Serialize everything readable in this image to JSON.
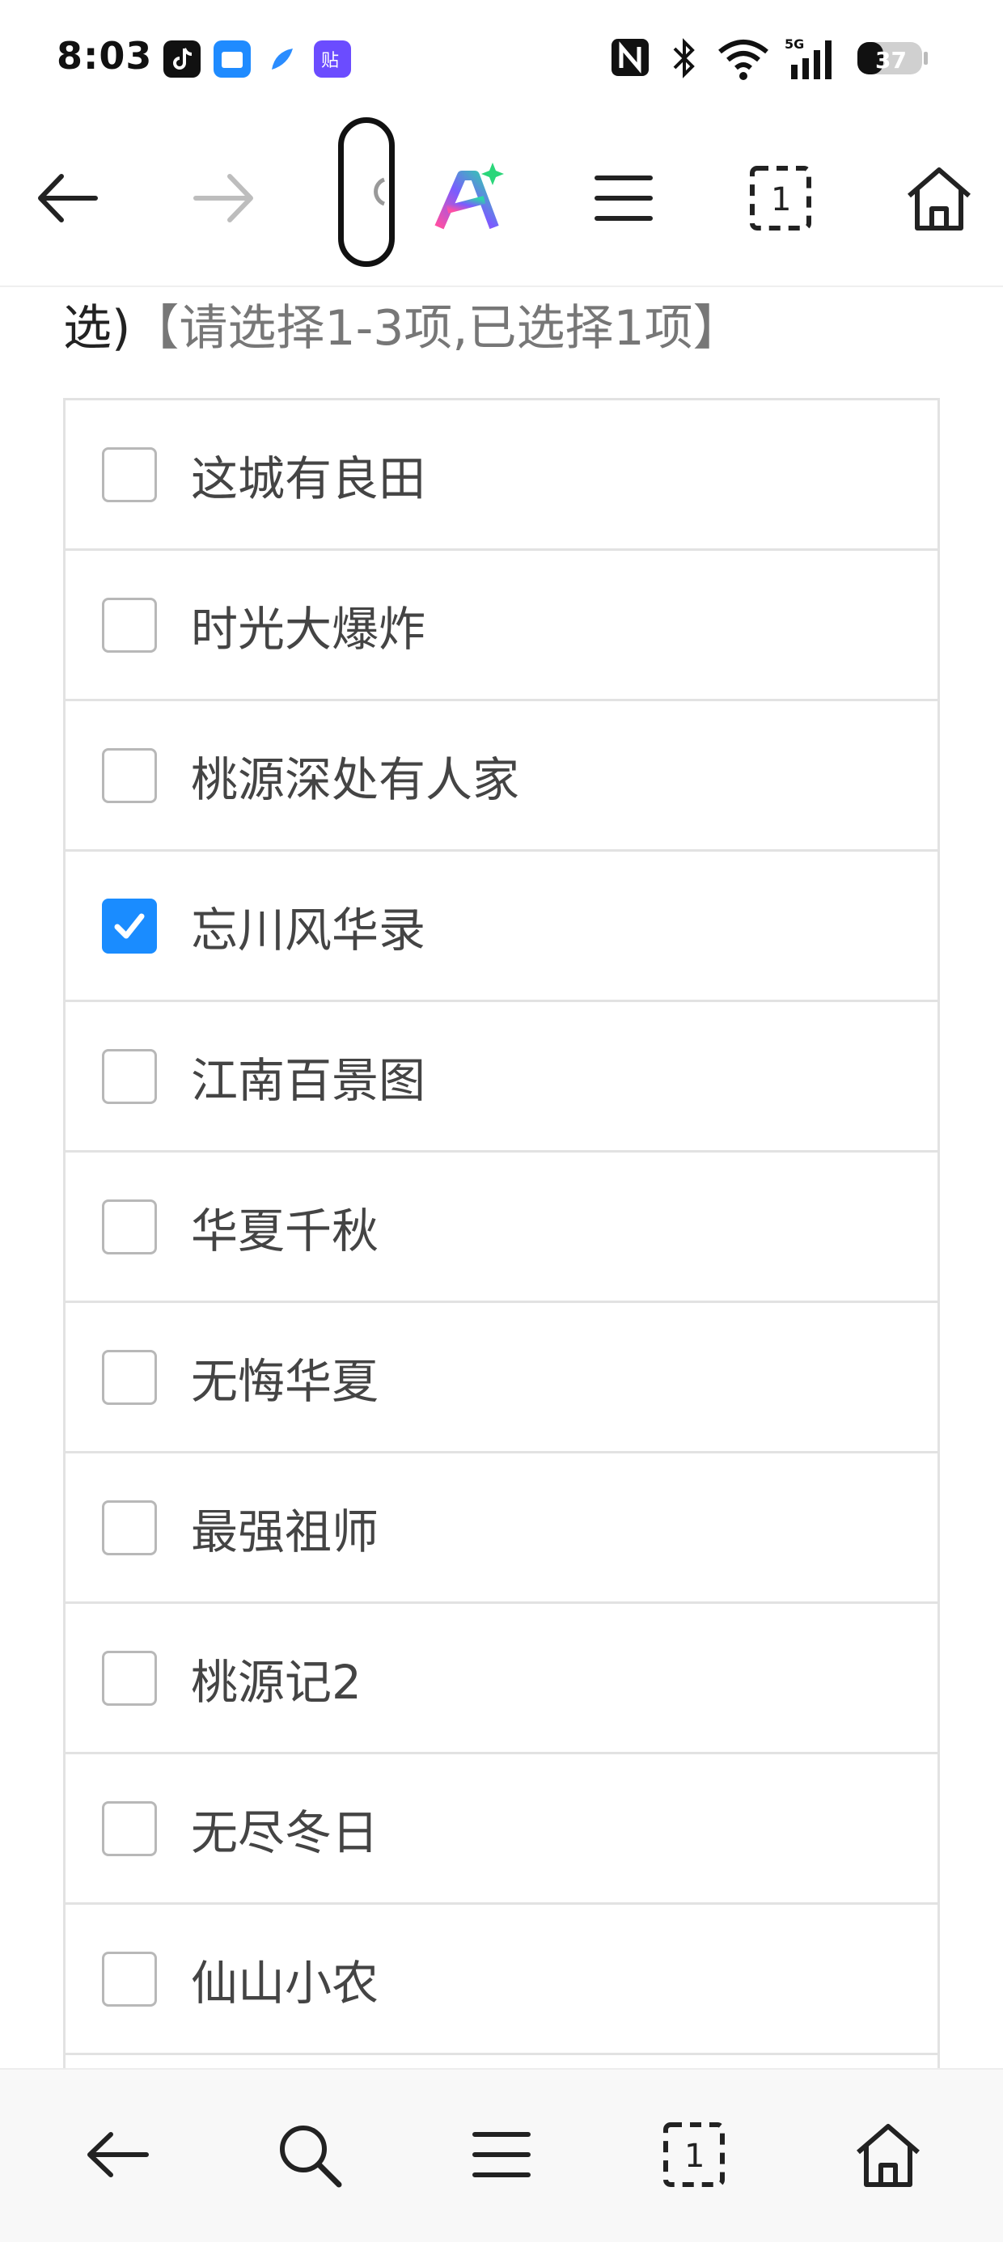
{
  "status_bar": {
    "time": "8:03",
    "battery": "37",
    "network": "5G",
    "app_icons": [
      "tiktok-icon",
      "files-icon",
      "feather-icon",
      "sticker-icon"
    ],
    "status_icons": [
      "nfc-icon",
      "bluetooth-icon",
      "wifi-icon",
      "signal-icon",
      "battery-icon"
    ]
  },
  "toolbar": {
    "back": "back-icon",
    "forward": "forward-icon",
    "ai": "ai-assistant-icon",
    "menu": "menu-icon",
    "tabs_count": "1",
    "home": "home-icon"
  },
  "question": {
    "text_end": "选)",
    "hint": "【请选择1-3项,已选择1项】"
  },
  "options": [
    {
      "label": "这城有良田",
      "checked": false
    },
    {
      "label": "时光大爆炸",
      "checked": false
    },
    {
      "label": "桃源深处有人家",
      "checked": false
    },
    {
      "label": "忘川风华录",
      "checked": true
    },
    {
      "label": "江南百景图",
      "checked": false
    },
    {
      "label": "华夏千秋",
      "checked": false
    },
    {
      "label": "无悔华夏",
      "checked": false
    },
    {
      "label": "最强祖师",
      "checked": false
    },
    {
      "label": "桃源记2",
      "checked": false
    },
    {
      "label": "无尽冬日",
      "checked": false
    },
    {
      "label": "仙山小农",
      "checked": false
    }
  ],
  "bottom_nav": {
    "tabs_count": "1"
  },
  "colors": {
    "accent": "#1a8cff",
    "ai_gradient": [
      "#ff4fa3",
      "#7a5cff",
      "#2bd6a8"
    ]
  }
}
